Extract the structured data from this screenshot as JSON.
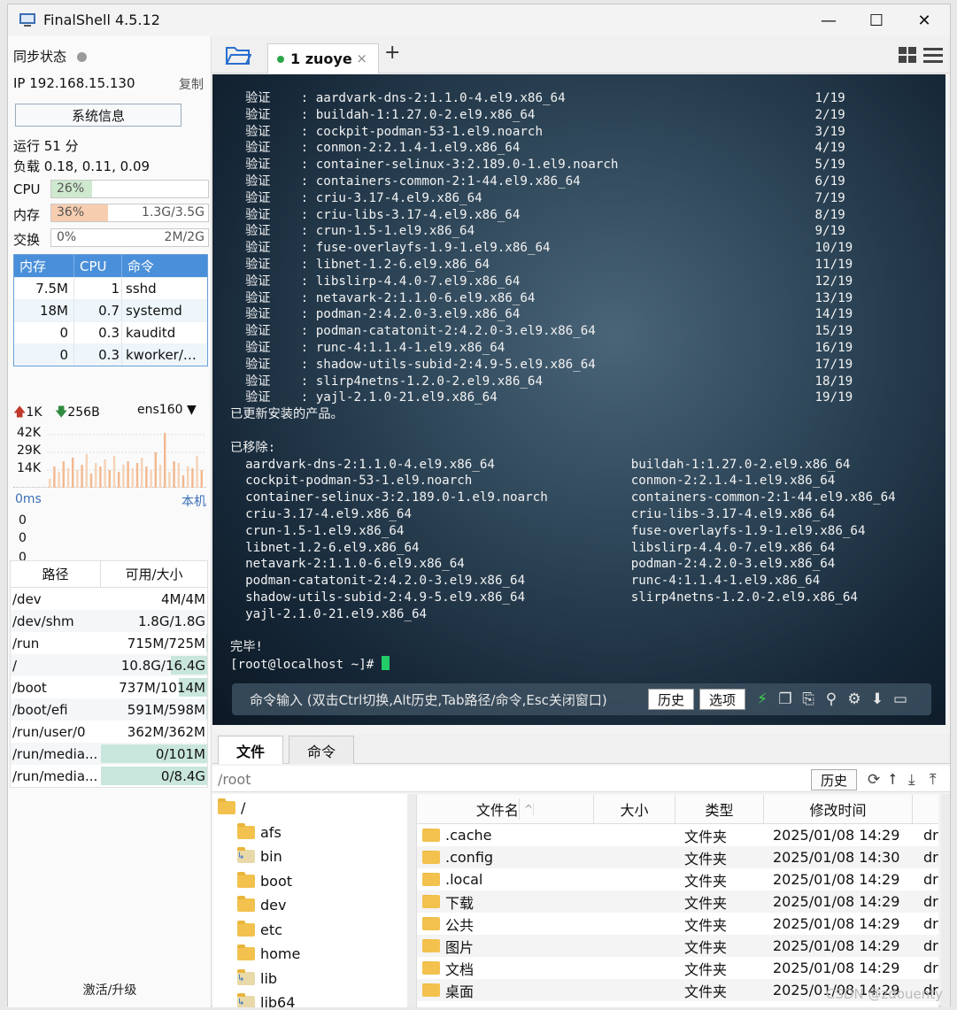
{
  "window": {
    "title": "FinalShell 4.5.12",
    "minimize": "—",
    "maximize": "☐",
    "close": "✕"
  },
  "left": {
    "sync_label": "同步状态",
    "ip_label": "IP  192.168.15.130",
    "copy_label": "复制",
    "sysinfo_button": "系统信息",
    "uptime": "运行 51 分",
    "load": "负载 0.18, 0.11, 0.09",
    "cpu": {
      "label": "CPU",
      "pct": "26%",
      "value": 0.26,
      "color": "#cfe9cf"
    },
    "mem": {
      "label": "内存",
      "pct": "36%",
      "amount": "1.3G/3.5G",
      "value": 0.36,
      "color": "#f7cdb0"
    },
    "swap": {
      "label": "交换",
      "pct": "0%",
      "amount": "2M/2G",
      "value": 0.0
    },
    "proc_headers": [
      "内存",
      "CPU",
      "命令"
    ],
    "procs": [
      {
        "mem": "7.5M",
        "cpu": "1",
        "cmd": "sshd"
      },
      {
        "mem": "18M",
        "cpu": "0.7",
        "cmd": "systemd"
      },
      {
        "mem": "0",
        "cpu": "0.3",
        "cmd": "kauditd"
      },
      {
        "mem": "0",
        "cpu": "0.3",
        "cmd": "kworker/…"
      }
    ],
    "net_up": "1K",
    "net_down": "256B",
    "net_iface": "ens160",
    "net_scale": [
      "42K",
      "29K",
      "14K"
    ],
    "ping_label": "0ms",
    "ping_host": "本机",
    "ping_scale": [
      "0",
      "0",
      "0"
    ],
    "disk_headers": [
      "路径",
      "可用/大小"
    ],
    "disks": [
      {
        "path": "/dev",
        "avail": "4M/4M",
        "used": 0.0
      },
      {
        "path": "/dev/shm",
        "avail": "1.8G/1.8G",
        "used": 0.0
      },
      {
        "path": "/run",
        "avail": "715M/725M",
        "used": 0.01
      },
      {
        "path": "/",
        "avail": "10.8G/16.4G",
        "used": 0.34
      },
      {
        "path": "/boot",
        "avail": "737M/1014M",
        "used": 0.27
      },
      {
        "path": "/boot/efi",
        "avail": "591M/598M",
        "used": 0.01
      },
      {
        "path": "/run/user/0",
        "avail": "362M/362M",
        "used": 0.0
      },
      {
        "path": "/run/media...",
        "avail": "0/101M",
        "used": 1.0
      },
      {
        "path": "/run/media...",
        "avail": "0/8.4G",
        "used": 1.0
      }
    ],
    "activate": "激活/升级"
  },
  "tabs": {
    "session_number": "1",
    "session_name": "zuoye",
    "close": "×",
    "add": "+"
  },
  "terminal": {
    "verify_lines": [
      [
        "验证",
        ": aardvark-dns-2:1.1.0-4.el9.x86_64",
        "1/19"
      ],
      [
        "验证",
        ": buildah-1:1.27.0-2.el9.x86_64",
        "2/19"
      ],
      [
        "验证",
        ": cockpit-podman-53-1.el9.noarch",
        "3/19"
      ],
      [
        "验证",
        ": conmon-2:2.1.4-1.el9.x86_64",
        "4/19"
      ],
      [
        "验证",
        ": container-selinux-3:2.189.0-1.el9.noarch",
        "5/19"
      ],
      [
        "验证",
        ": containers-common-2:1-44.el9.x86_64",
        "6/19"
      ],
      [
        "验证",
        ": criu-3.17-4.el9.x86_64",
        "7/19"
      ],
      [
        "验证",
        ": criu-libs-3.17-4.el9.x86_64",
        "8/19"
      ],
      [
        "验证",
        ": crun-1.5-1.el9.x86_64",
        "9/19"
      ],
      [
        "验证",
        ": fuse-overlayfs-1.9-1.el9.x86_64",
        "10/19"
      ],
      [
        "验证",
        ": libnet-1.2-6.el9.x86_64",
        "11/19"
      ],
      [
        "验证",
        ": libslirp-4.4.0-7.el9.x86_64",
        "12/19"
      ],
      [
        "验证",
        ": netavark-2:1.1.0-6.el9.x86_64",
        "13/19"
      ],
      [
        "验证",
        ": podman-2:4.2.0-3.el9.x86_64",
        "14/19"
      ],
      [
        "验证",
        ": podman-catatonit-2:4.2.0-3.el9.x86_64",
        "15/19"
      ],
      [
        "验证",
        ": runc-4:1.1.4-1.el9.x86_64",
        "16/19"
      ],
      [
        "验证",
        ": shadow-utils-subid-2:4.9-5.el9.x86_64",
        "17/19"
      ],
      [
        "验证",
        ": slirp4netns-1.2.0-2.el9.x86_64",
        "18/19"
      ],
      [
        "验证",
        ": yajl-2.1.0-21.el9.x86_64",
        "19/19"
      ]
    ],
    "updated_msg": "已更新安装的产品。",
    "removed_label": "已移除:",
    "removed": [
      [
        "aardvark-dns-2:1.1.0-4.el9.x86_64",
        "buildah-1:1.27.0-2.el9.x86_64"
      ],
      [
        "cockpit-podman-53-1.el9.noarch",
        "conmon-2:2.1.4-1.el9.x86_64"
      ],
      [
        "container-selinux-3:2.189.0-1.el9.noarch",
        "containers-common-2:1-44.el9.x86_64"
      ],
      [
        "criu-3.17-4.el9.x86_64",
        "criu-libs-3.17-4.el9.x86_64"
      ],
      [
        "crun-1.5-1.el9.x86_64",
        "fuse-overlayfs-1.9-1.el9.x86_64"
      ],
      [
        "libnet-1.2-6.el9.x86_64",
        "libslirp-4.4.0-7.el9.x86_64"
      ],
      [
        "netavark-2:1.1.0-6.el9.x86_64",
        "podman-2:4.2.0-3.el9.x86_64"
      ],
      [
        "podman-catatonit-2:4.2.0-3.el9.x86_64",
        "runc-4:1.1.4-1.el9.x86_64"
      ],
      [
        "shadow-utils-subid-2:4.9-5.el9.x86_64",
        "slirp4netns-1.2.0-2.el9.x86_64"
      ],
      [
        "yajl-2.1.0-21.el9.x86_64",
        ""
      ]
    ],
    "done_msg": "完毕!",
    "prompt": "[root@localhost ~]# ",
    "cmd_hint": "命令输入 (双击Ctrl切换,Alt历史,Tab路径/命令,Esc关闭窗口)",
    "history_btn": "历史",
    "options_btn": "选项"
  },
  "files": {
    "tab_files": "文件",
    "tab_cmds": "命令",
    "path": "/root",
    "history_btn": "历史",
    "tree": [
      {
        "name": "/",
        "type": "root"
      },
      {
        "name": "afs",
        "type": "dir"
      },
      {
        "name": "bin",
        "type": "link"
      },
      {
        "name": "boot",
        "type": "dir"
      },
      {
        "name": "dev",
        "type": "dir"
      },
      {
        "name": "etc",
        "type": "dir"
      },
      {
        "name": "home",
        "type": "dir"
      },
      {
        "name": "lib",
        "type": "link"
      },
      {
        "name": "lib64",
        "type": "link"
      }
    ],
    "headers": [
      "文件名",
      "大小",
      "类型",
      "修改时间"
    ],
    "sort_marker": "^",
    "rows": [
      {
        "name": ".cache",
        "size": "",
        "type": "文件夹",
        "modified": "2025/01/08 14:29",
        "perm": "dr"
      },
      {
        "name": ".config",
        "size": "",
        "type": "文件夹",
        "modified": "2025/01/08 14:30",
        "perm": "dr"
      },
      {
        "name": ".local",
        "size": "",
        "type": "文件夹",
        "modified": "2025/01/08 14:29",
        "perm": "dr"
      },
      {
        "name": "下载",
        "size": "",
        "type": "文件夹",
        "modified": "2025/01/08 14:29",
        "perm": "dr"
      },
      {
        "name": "公共",
        "size": "",
        "type": "文件夹",
        "modified": "2025/01/08 14:29",
        "perm": "dr"
      },
      {
        "name": "图片",
        "size": "",
        "type": "文件夹",
        "modified": "2025/01/08 14:29",
        "perm": "dr"
      },
      {
        "name": "文档",
        "size": "",
        "type": "文件夹",
        "modified": "2025/01/08 14:29",
        "perm": "dr"
      },
      {
        "name": "桌面",
        "size": "",
        "type": "文件夹",
        "modified": "2025/01/08 14:29",
        "perm": "dr"
      }
    ]
  },
  "watermark": "CSDN @zdouenty"
}
